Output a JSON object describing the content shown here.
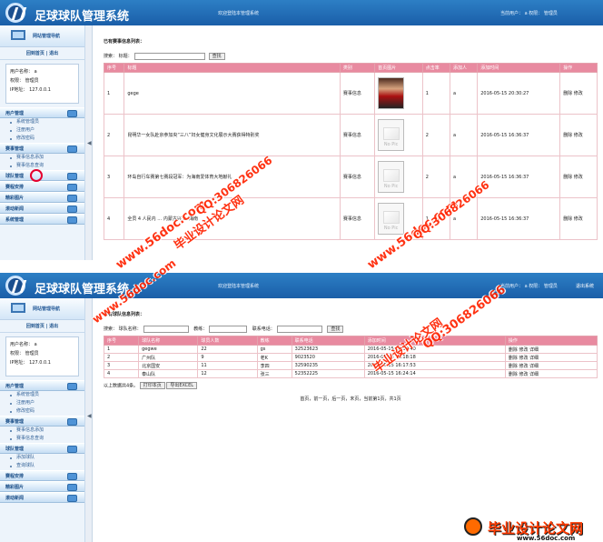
{
  "app": {
    "site_title": "足球球队管理系统",
    "welcome": "欢迎登陆本管理系统",
    "current_user": "当前用户： a  权限： 管理员",
    "logout": "退出系统"
  },
  "sidebar": {
    "title": "网站管理导航",
    "quicklinks": "回到首页 | 退出",
    "username_label": "用户名称： a",
    "role_label": "权限： 管理员",
    "ip_label": "IP地址： 127.0.0.1"
  },
  "screen1": {
    "nav": [
      {
        "label": "用户管理",
        "type": "cat"
      },
      {
        "label": "系统管理员",
        "type": "sub"
      },
      {
        "label": "注册用户",
        "type": "sub"
      },
      {
        "label": "修改密码",
        "type": "sub"
      },
      {
        "label": "赛事管理",
        "type": "cat"
      },
      {
        "label": "赛事信息添加",
        "type": "sub"
      },
      {
        "label": "赛事信息查询",
        "type": "sub"
      },
      {
        "label": "球队管理",
        "type": "cat"
      },
      {
        "label": "赛程安排",
        "type": "cat"
      },
      {
        "label": "精彩图片",
        "type": "cat"
      },
      {
        "label": "滚动新闻",
        "type": "cat"
      },
      {
        "label": "系统管理",
        "type": "cat"
      }
    ],
    "section_title": "已有赛事信息列表：",
    "search_label": "搜索：  标题：",
    "search_button": "查找",
    "headers": [
      "序号",
      "标题",
      "类别",
      "首页图片",
      "点击率",
      "添加人",
      "添加时间",
      "操作"
    ],
    "rows": [
      [
        "1",
        "gege",
        "赛事信息",
        "real",
        "1",
        "a",
        "2016-05-15 20:30:27",
        "删除 修改"
      ],
      [
        "2",
        "昆明华一女队赴京参加央“三八”妇女健身文化展示大赛获得特别奖",
        "赛事信息",
        "placeholder",
        "2",
        "a",
        "2016-05-15 16:36:37",
        "删除 修改"
      ],
      [
        "3",
        "环岛自行车赛第七赛段冠军：为海南爱体育大地献礼",
        "赛事信息",
        "placeholder",
        "2",
        "a",
        "2016-05-15 16:36:37",
        "删除 修改"
      ],
      [
        "4",
        "全员 4 人民内 … 内蒙古兴 … 海南",
        "赛事信息",
        "placeholder",
        "1",
        "a",
        "2016-05-15 16:36:37",
        "删除 修改"
      ]
    ],
    "no_pic": "No Pic"
  },
  "screen2": {
    "nav": [
      {
        "label": "用户管理",
        "type": "cat"
      },
      {
        "label": "系统管理员",
        "type": "sub"
      },
      {
        "label": "注册用户",
        "type": "sub"
      },
      {
        "label": "修改密码",
        "type": "sub"
      },
      {
        "label": "赛事管理",
        "type": "cat"
      },
      {
        "label": "赛事信息添加",
        "type": "sub"
      },
      {
        "label": "赛事信息查询",
        "type": "sub"
      },
      {
        "label": "球队管理",
        "type": "cat"
      },
      {
        "label": "添加球队",
        "type": "sub"
      },
      {
        "label": "查询球队",
        "type": "sub"
      },
      {
        "label": "赛程安排",
        "type": "cat"
      },
      {
        "label": "精彩图片",
        "type": "cat"
      },
      {
        "label": "滚动新闻",
        "type": "cat"
      }
    ],
    "section_title": "已有球队信息列表：",
    "search_labels": [
      "搜索：  球队名称：",
      "教练：",
      "联系电话："
    ],
    "search_button": "查找",
    "headers": [
      "序号",
      "球队名称",
      "球员人数",
      "教练",
      "联系电话",
      "添加时间",
      "操作"
    ],
    "rows": [
      [
        "1",
        "gegwe",
        "22",
        "gs",
        "32523623",
        "2016-05-15 20:30:40",
        "删除 修改 详细"
      ],
      [
        "2",
        "广州队",
        "9",
        "老K",
        "9023520",
        "2016-05-15 16:18:18",
        "删除 修改 详细"
      ],
      [
        "3",
        "北京国安",
        "11",
        "李四",
        "32590235",
        "2016-05-15 16:17:53",
        "删除 修改 详细"
      ],
      [
        "4",
        "泰山队",
        "12",
        "张三",
        "52352225",
        "2016-05-15 16:24:14",
        "删除 修改 详细"
      ]
    ],
    "summary": "以上数据共4条。",
    "print_button": "打印本页",
    "export_button": "导出EXCEL",
    "pager": "首页，前一页，后一页，末页，当前第1页，共1页"
  },
  "watermarks": {
    "wm1": "www.56doc.com",
    "wm2": "毕业设计论文网",
    "wm3": "QQ:306826066",
    "wm4": "www.56doc.com",
    "wm5": "QQ:306826066",
    "wm6": "www.56doc.com",
    "wm7": "毕业设计论文网",
    "wm8": "QQ:306826066"
  },
  "footer": {
    "title": "毕业设计论文网",
    "url": "www.56doc.com"
  }
}
